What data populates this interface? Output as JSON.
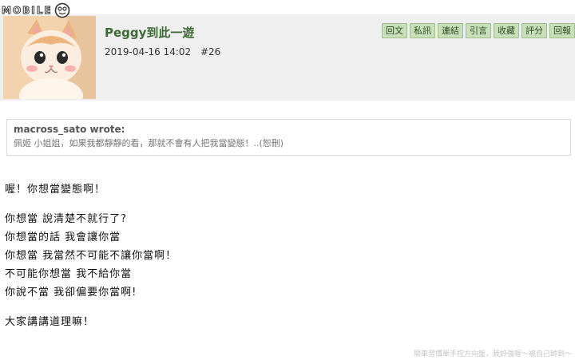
{
  "site": {
    "logo_text": "MOBILE"
  },
  "post_header": {
    "username": "Peggy到此一遊",
    "timestamp": "2019-04-16 14:02",
    "floor": "#26"
  },
  "actions": [
    {
      "label": "回文"
    },
    {
      "label": "私訊"
    },
    {
      "label": "連結"
    },
    {
      "label": "引言"
    },
    {
      "label": "收藏"
    },
    {
      "label": "評分"
    },
    {
      "label": "回報"
    }
  ],
  "quote": {
    "author": "macross_sato wrote:",
    "text": "佩姬 小姐姐，如果我都靜靜的看，那就不會有人把我當變態！..(恕刪)"
  },
  "post_body": {
    "para1": [
      "喔！你想當變態啊！"
    ],
    "para2": [
      "你想當 說清楚不就行了?",
      "你想當的話 我會讓你當",
      "你想當 我當然不可能不讓你當啊！",
      "不可能你想當 我不給你當",
      "你說不當 我卻偏要你當啊!"
    ],
    "para3": [
      "大家講講道理嘛！"
    ]
  },
  "signature": "開車習慣單手控方向盤，我好強喔～被自己帥到～"
}
